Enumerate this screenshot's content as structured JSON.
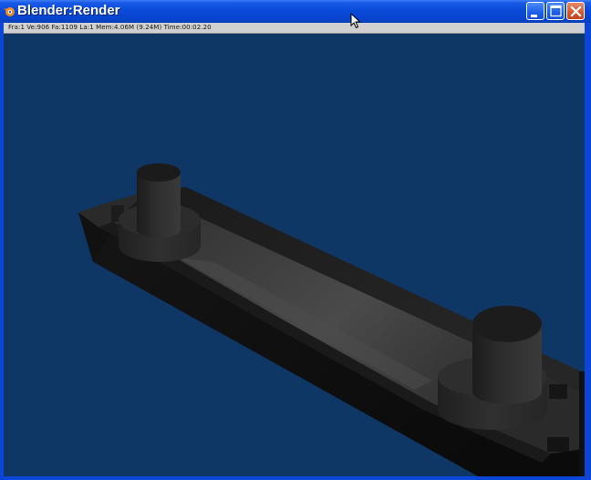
{
  "window": {
    "title": "Blender:Render",
    "controls": {
      "minimize": "minimize",
      "maximize": "maximize",
      "close": "close"
    },
    "app_icon": "blender-logo-icon"
  },
  "render": {
    "status": "Fra:1  Ve:906 Fa:1109 La:1 Mem:4.06M (9.24M) Time:00:02.20",
    "background_color": "#0f3765",
    "object_color": "#3a3a3a"
  },
  "colors": {
    "titlebar": "#0a4ad8",
    "window_frame": "#0c46d8",
    "close_button": "#d3552e",
    "statusbar": "#d0d0d0"
  }
}
